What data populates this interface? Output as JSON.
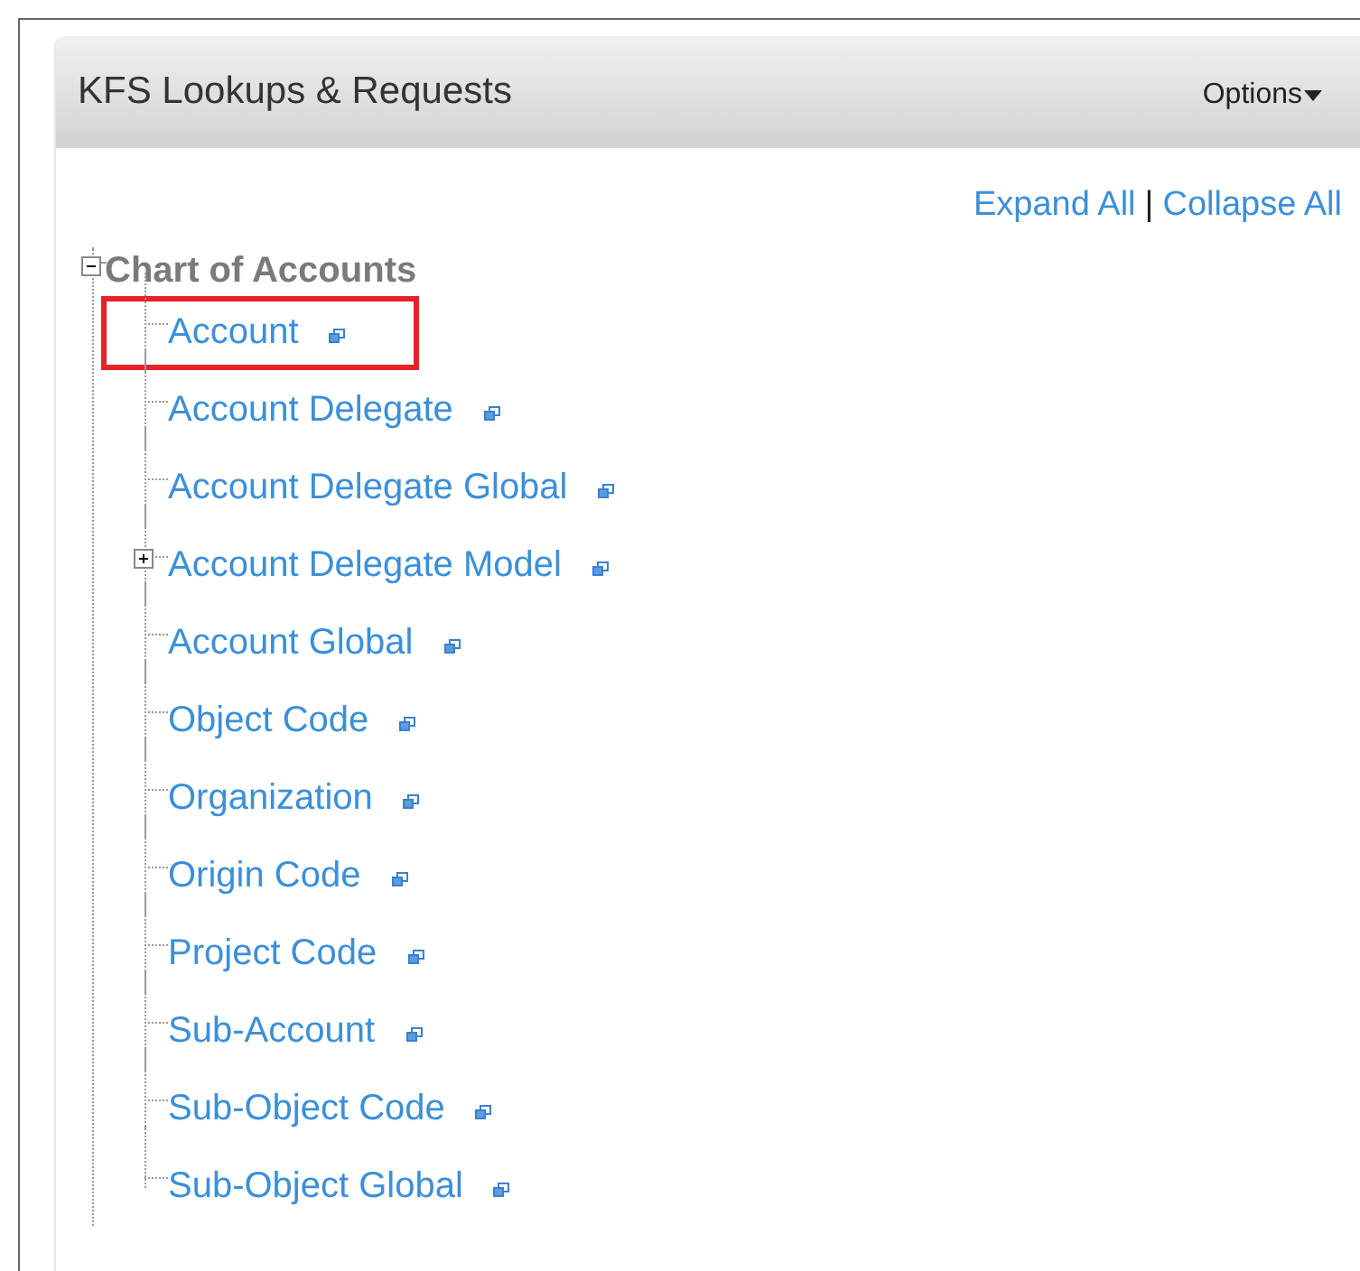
{
  "panel": {
    "title": "KFS Lookups & Requests",
    "options_label": "Options"
  },
  "tree_controls": {
    "expand_all": "Expand All",
    "separator": "|",
    "collapse_all": "Collapse All"
  },
  "tree": [
    {
      "label": "Chart of Accounts",
      "expanded": true,
      "children": [
        {
          "label": "Account",
          "highlighted": true
        },
        {
          "label": "Account Delegate",
          "highlighted": false
        },
        {
          "label": "Account Delegate Global",
          "highlighted": false
        },
        {
          "label": "Account Delegate Model",
          "highlighted": false,
          "expanded": false
        },
        {
          "label": "Account Global",
          "highlighted": false
        },
        {
          "label": "Object Code",
          "highlighted": false
        },
        {
          "label": "Organization",
          "highlighted": false
        },
        {
          "label": "Origin Code",
          "highlighted": false
        },
        {
          "label": "Project Code",
          "highlighted": false
        },
        {
          "label": "Sub-Account",
          "highlighted": false
        },
        {
          "label": "Sub-Object Code",
          "highlighted": false
        },
        {
          "label": "Sub-Object Global",
          "highlighted": false
        }
      ]
    }
  ]
}
